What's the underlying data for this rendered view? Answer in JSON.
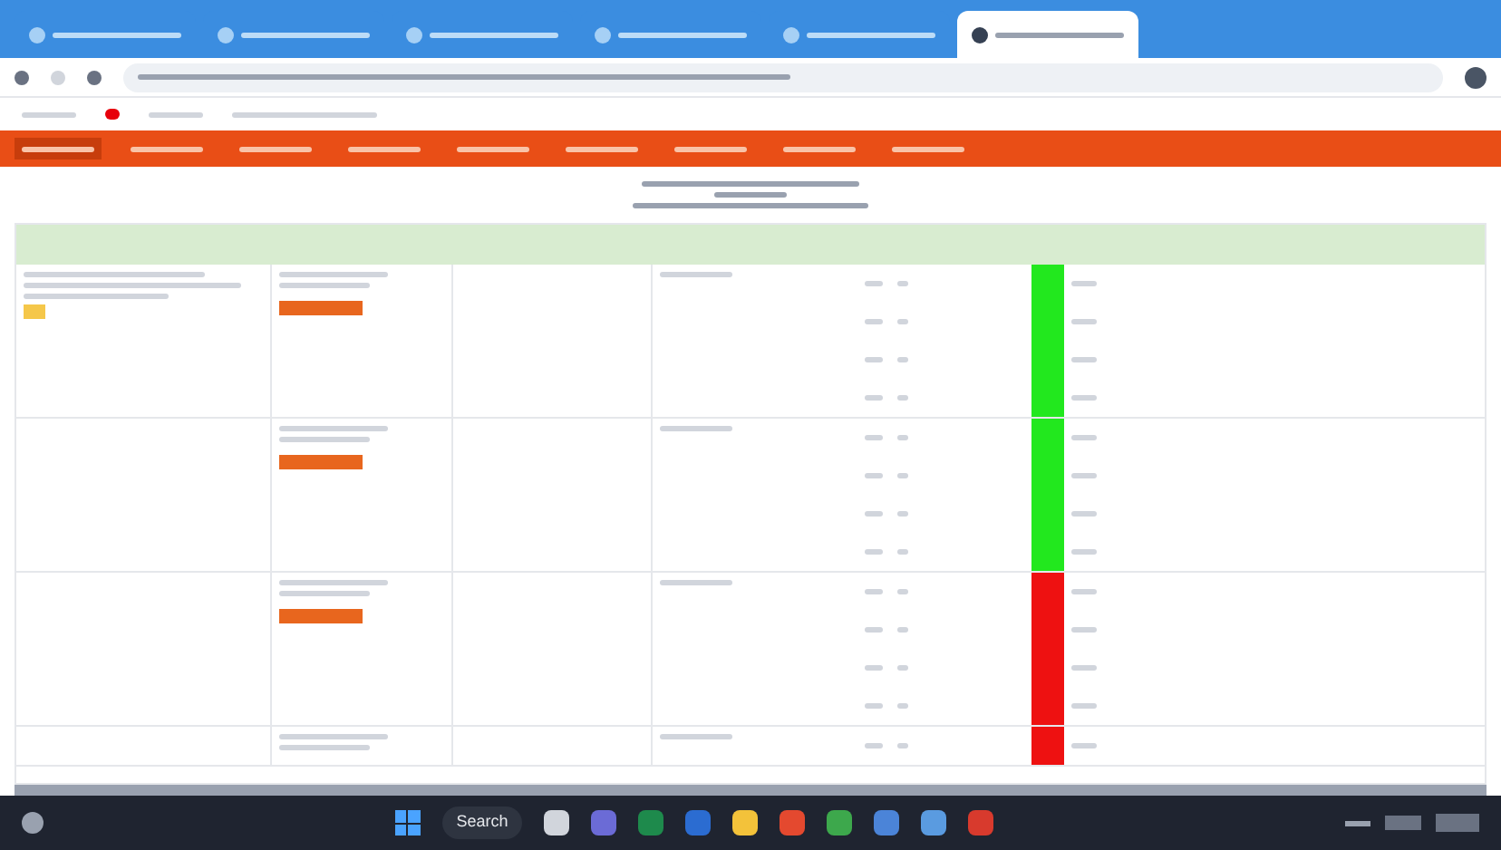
{
  "browser": {
    "tabs": [
      {
        "selected": false
      },
      {
        "selected": false
      },
      {
        "selected": false
      },
      {
        "selected": false
      },
      {
        "selected": false
      },
      {
        "selected": true
      }
    ]
  },
  "nav": {
    "items": [
      {
        "selected": true
      },
      {
        "selected": false
      },
      {
        "selected": false
      },
      {
        "selected": false
      },
      {
        "selected": false
      },
      {
        "selected": false
      },
      {
        "selected": false
      },
      {
        "selected": false
      },
      {
        "selected": false
      }
    ]
  },
  "table": {
    "groups": [
      {
        "rows": [
          {
            "color": "#22e81e"
          },
          {
            "color": "#22e81e"
          },
          {
            "color": "#22e81e"
          },
          {
            "color": "#22e81e"
          }
        ]
      },
      {
        "rows": [
          {
            "color": "#22e81e"
          },
          {
            "color": "#22e81e"
          },
          {
            "color": "#22e81e"
          },
          {
            "color": "#22e81e"
          }
        ]
      },
      {
        "rows": [
          {
            "color": "#ee1111"
          },
          {
            "color": "#ee1111"
          },
          {
            "color": "#ee1111"
          },
          {
            "color": "#ee1111"
          }
        ]
      },
      {
        "rows": [
          {
            "color": "#ee1111"
          }
        ]
      }
    ]
  },
  "taskbar": {
    "search": "Search"
  }
}
